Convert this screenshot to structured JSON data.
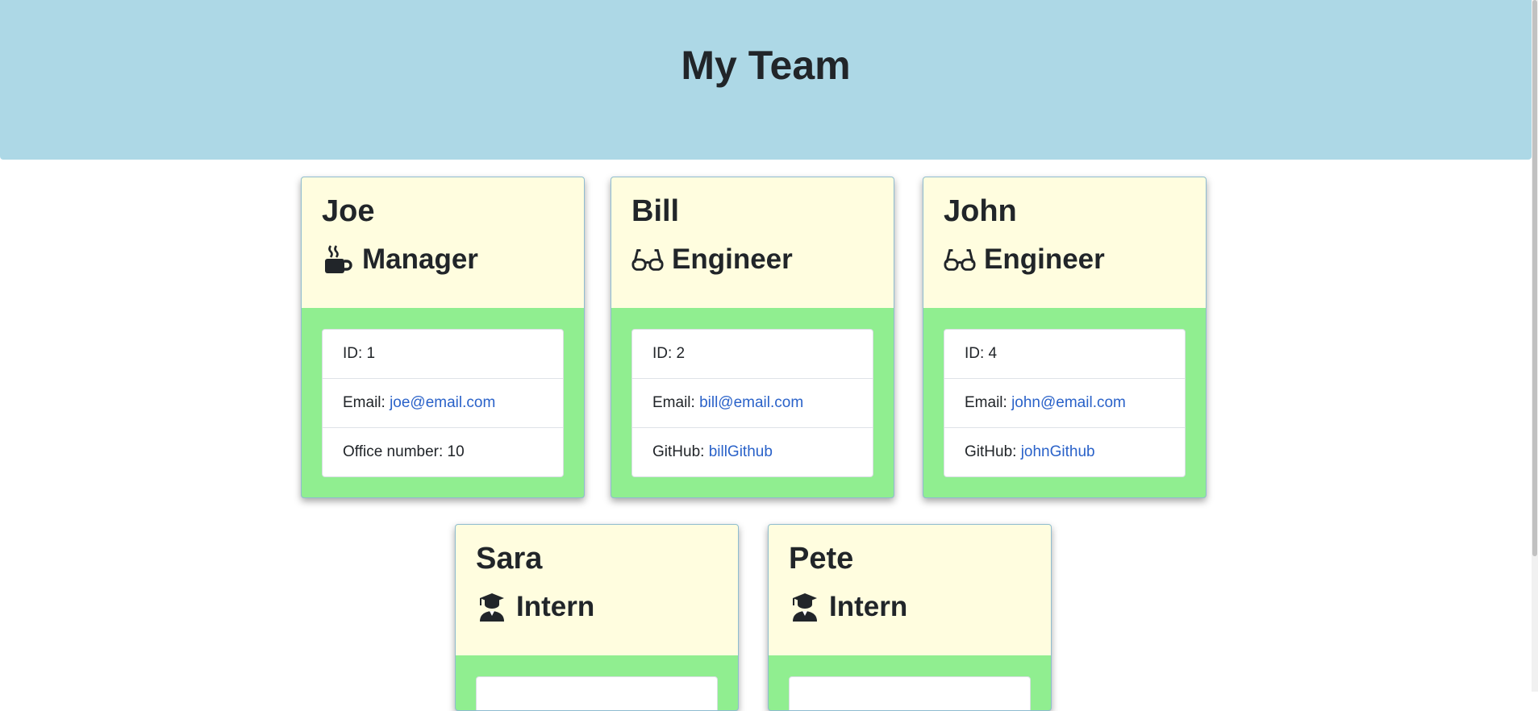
{
  "header": {
    "title": "My Team"
  },
  "team": [
    {
      "name": "Joe",
      "role": "Manager",
      "icon": "coffee-icon",
      "id_label": "ID: 1",
      "email_label": "Email: ",
      "email": "joe@email.com",
      "extra_label": "Office number: 10",
      "extra_value": ""
    },
    {
      "name": "Bill",
      "role": "Engineer",
      "icon": "glasses-icon",
      "id_label": "ID: 2",
      "email_label": "Email: ",
      "email": "bill@email.com",
      "extra_label": "GitHub: ",
      "extra_value": "billGithub"
    },
    {
      "name": "John",
      "role": "Engineer",
      "icon": "glasses-icon",
      "id_label": "ID: 4",
      "email_label": "Email: ",
      "email": "john@email.com",
      "extra_label": "GitHub: ",
      "extra_value": "johnGithub"
    },
    {
      "name": "Sara",
      "role": "Intern",
      "icon": "graduate-icon"
    },
    {
      "name": "Pete",
      "role": "Intern",
      "icon": "graduate-icon"
    }
  ],
  "colors": {
    "header_bg": "#add8e6",
    "card_head_bg": "#fffddf",
    "card_body_bg": "#90ee90",
    "link": "#2a62c9"
  }
}
